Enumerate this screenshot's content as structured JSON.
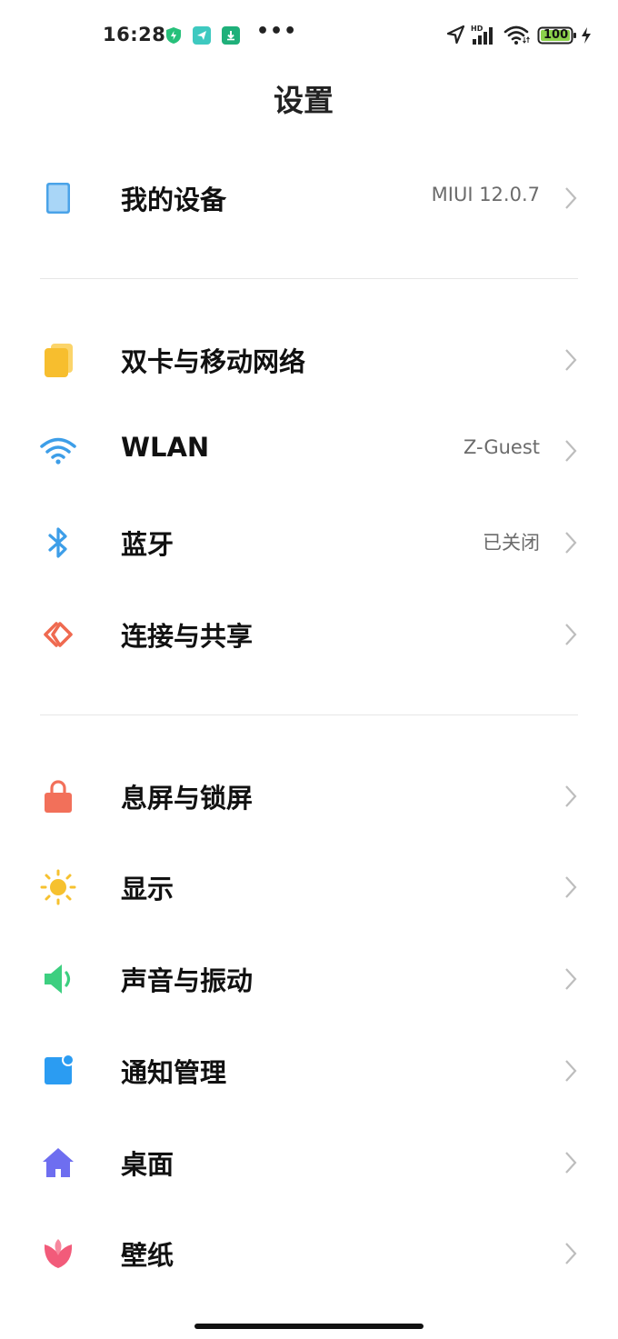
{
  "status_bar": {
    "time": "16:28",
    "apps": [
      "shield-app-icon",
      "paper-plane-app-icon",
      "download-app-icon"
    ],
    "more": "•••",
    "network_badge": "HD",
    "battery_level": "100",
    "battery_color": "#8bd14b"
  },
  "page": {
    "title": "设置"
  },
  "sections": [
    {
      "items": [
        {
          "label": "我的设备",
          "value": "MIUI 12.0.7",
          "icon": "device-icon"
        }
      ]
    },
    {
      "items": [
        {
          "label": "双卡与移动网络",
          "value": "",
          "icon": "sim-card-icon"
        },
        {
          "label": "WLAN",
          "value": "Z-Guest",
          "icon": "wifi-icon"
        },
        {
          "label": "蓝牙",
          "value": "已关闭",
          "icon": "bluetooth-icon"
        },
        {
          "label": "连接与共享",
          "value": "",
          "icon": "connection-share-icon"
        }
      ]
    },
    {
      "items": [
        {
          "label": "息屏与锁屏",
          "value": "",
          "icon": "lock-icon"
        },
        {
          "label": "显示",
          "value": "",
          "icon": "sun-icon"
        },
        {
          "label": "声音与振动",
          "value": "",
          "icon": "speaker-icon"
        },
        {
          "label": "通知管理",
          "value": "",
          "icon": "notification-icon"
        },
        {
          "label": "桌面",
          "value": "",
          "icon": "home-icon"
        },
        {
          "label": "壁纸",
          "value": "",
          "icon": "flower-icon"
        }
      ]
    }
  ],
  "colors": {
    "device": "#4aa3e8",
    "sim": "#f7be2e",
    "wifi": "#3d9ee8",
    "bluetooth": "#3d9ee8",
    "share": "#ef6a50",
    "lock": "#f2705a",
    "sun": "#f6c12f",
    "speaker": "#3dcf80",
    "notification": "#2b9cf2",
    "home": "#6e6ef0",
    "flower": "#f25b7a"
  }
}
